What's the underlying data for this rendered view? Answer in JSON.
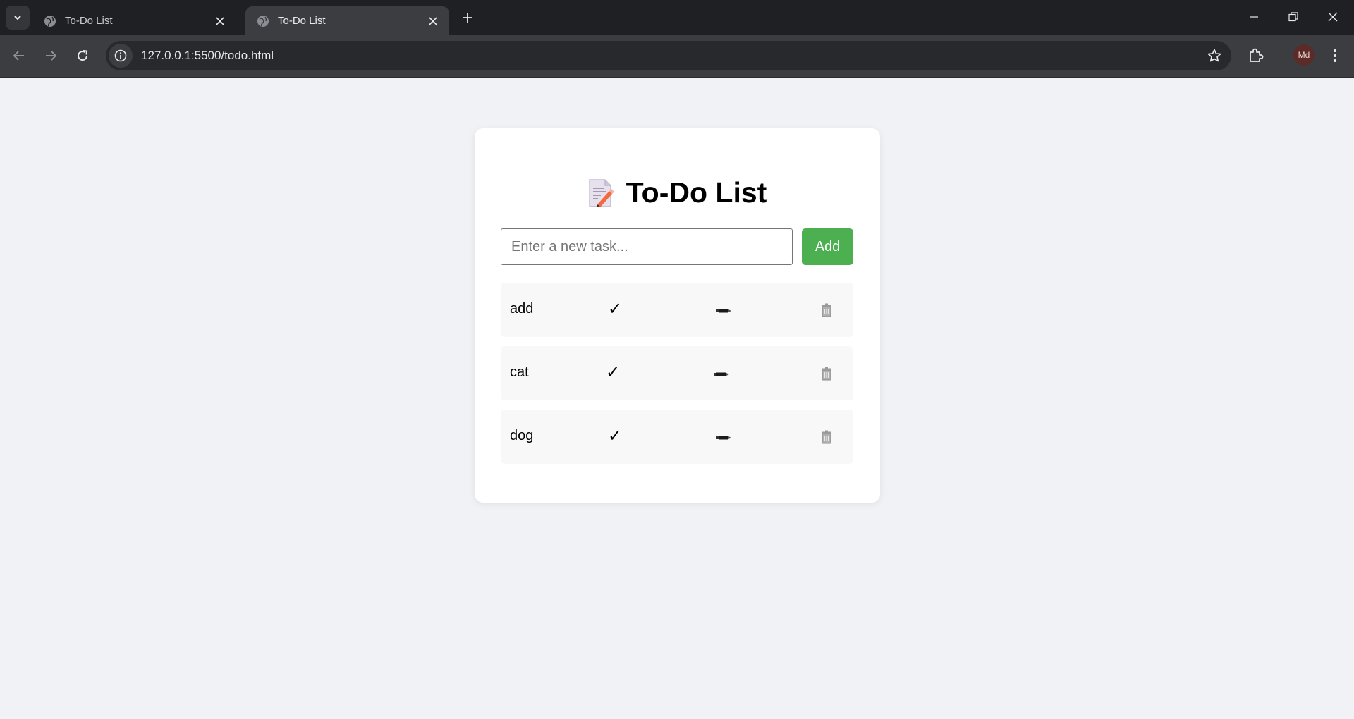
{
  "browser": {
    "tabs": [
      {
        "title": "To-Do List",
        "active": false
      },
      {
        "title": "To-Do List",
        "active": true
      }
    ],
    "url": "127.0.0.1:5500/todo.html",
    "profile_initials": "Md"
  },
  "app": {
    "title": "To-Do List",
    "input_placeholder": "Enter a new task...",
    "input_value": "",
    "add_label": "Add",
    "check_symbol": "✓",
    "tasks": [
      {
        "text": "add"
      },
      {
        "text": "cat"
      },
      {
        "text": "dog"
      }
    ],
    "colors": {
      "accent": "#4caf50",
      "page_bg": "#f0f2f5",
      "task_bg": "#f8f8f8"
    }
  }
}
